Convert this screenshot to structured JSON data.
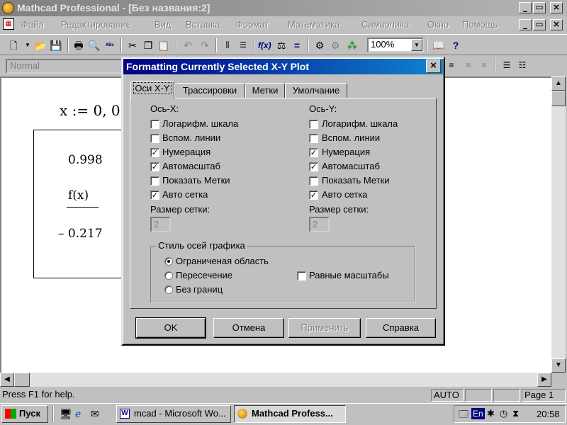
{
  "app": {
    "title": "Mathcad Professional - [Без названия:2]",
    "window_controls": [
      "_",
      "▭",
      "×"
    ],
    "doc_controls": [
      "_",
      "▭",
      "×"
    ]
  },
  "menu": [
    "Файл",
    "Редактирование",
    "Вид",
    "Вставка",
    "Формат",
    "Математика",
    "Символика",
    "Окно",
    "Помощь"
  ],
  "toolbar": {
    "zoom": "100%"
  },
  "formatbar": {
    "style": "Normal"
  },
  "worksheet": {
    "expr": "x := 0, 0.",
    "plot_ymax": "0.998",
    "plot_ylabel": "f(x)",
    "plot_ymin": "– 0.217"
  },
  "status": {
    "help": "Press F1 for help.",
    "mode": "AUTO",
    "page": "Page 1"
  },
  "taskbar": {
    "start": "Пуск",
    "tasks": [
      "mcad - Microsoft Wo...",
      "Mathcad Profess..."
    ],
    "lang": "En",
    "clock": "20:58"
  },
  "dialog": {
    "title": "Formatting Currently Selected X-Y Plot",
    "tabs": [
      "Оси X-Y",
      "Трассировки",
      "Метки",
      "Умолчание"
    ],
    "x_axis": {
      "heading": "Ось-X:",
      "options": [
        {
          "label": "Логарифм. шкала",
          "checked": false
        },
        {
          "label": "Вспом. линии",
          "checked": false
        },
        {
          "label": "Нумерация",
          "checked": true
        },
        {
          "label": "Автомасштаб",
          "checked": true
        },
        {
          "label": "Показать Метки",
          "checked": false
        },
        {
          "label": "Авто сетка",
          "checked": true
        }
      ],
      "grid_label": "Размер сетки:",
      "grid_value": "2"
    },
    "y_axis": {
      "heading": "Ось-Y:",
      "options": [
        {
          "label": "Логарифм. шкала",
          "checked": false
        },
        {
          "label": "Вспом. линии",
          "checked": false
        },
        {
          "label": "Нумерация",
          "checked": true
        },
        {
          "label": "Автомасштаб",
          "checked": true
        },
        {
          "label": "Показать Метки",
          "checked": false
        },
        {
          "label": "Авто сетка",
          "checked": true
        }
      ],
      "grid_label": "Размер сетки:",
      "grid_value": "2"
    },
    "axis_style": {
      "legend": "Стиль осей графика",
      "options": [
        {
          "label": "Ограниченая область",
          "selected": true
        },
        {
          "label": "Пересечение",
          "selected": false
        },
        {
          "label": "Без границ",
          "selected": false
        }
      ],
      "equal_scales": {
        "label": "Равные масштабы",
        "checked": false
      }
    },
    "buttons": {
      "ok": "OK",
      "cancel": "Отмена",
      "apply": "Применить",
      "help": "Справка"
    }
  }
}
